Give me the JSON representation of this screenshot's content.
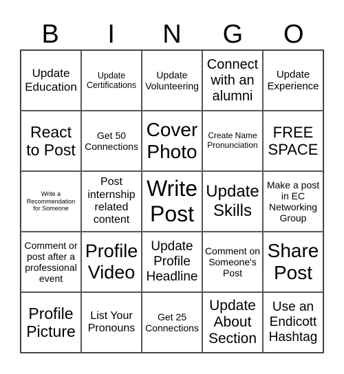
{
  "header": [
    "B",
    "I",
    "N",
    "G",
    "O"
  ],
  "cells": [
    "Update Education",
    "Update Certifications",
    "Update Volunteering",
    "Connect with an alumni",
    "Update Experience",
    "React to Post",
    "Get 50 Connections",
    "Cover Photo",
    "Create Name Pronunciation",
    "FREE SPACE",
    "Write a Recommendation for Someone",
    "Post internship related content",
    "Write Post",
    "Update Skills",
    "Make a post in EC Networking Group",
    "Comment or post after a professional event",
    "Profile Video",
    "Update Profile Headline",
    "Comment on Someone's Post",
    "Share Post",
    "Profile Picture",
    "List Your Pronouns",
    "Get 25 Connections",
    "Update About Section",
    "Use an Endicott Hashtag"
  ]
}
